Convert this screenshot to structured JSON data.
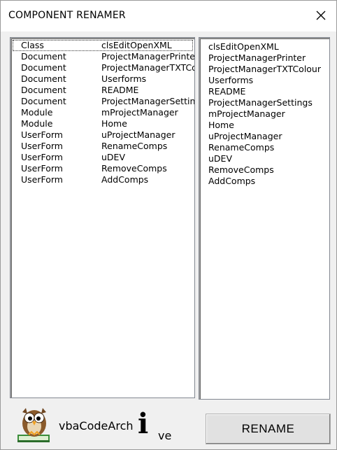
{
  "window": {
    "title": "COMPONENT RENAMER"
  },
  "left_list": {
    "rows": [
      {
        "type": "Class",
        "name": "clsEditOpenXML"
      },
      {
        "type": "Document",
        "name": "ProjectManagerPrinter"
      },
      {
        "type": "Document",
        "name": "ProjectManagerTXTColour"
      },
      {
        "type": "Document",
        "name": "Userforms"
      },
      {
        "type": "Document",
        "name": "README"
      },
      {
        "type": "Document",
        "name": "ProjectManagerSettings"
      },
      {
        "type": "Module",
        "name": "mProjectManager"
      },
      {
        "type": "Module",
        "name": "Home"
      },
      {
        "type": "UserForm",
        "name": "uProjectManager"
      },
      {
        "type": "UserForm",
        "name": "RenameComps"
      },
      {
        "type": "UserForm",
        "name": "uDEV"
      },
      {
        "type": "UserForm",
        "name": "RemoveComps"
      },
      {
        "type": "UserForm",
        "name": "AddComps"
      }
    ]
  },
  "right_list": {
    "items": [
      "clsEditOpenXML",
      "ProjectManagerPrinter",
      "ProjectManagerTXTColour",
      "Userforms",
      "README",
      "ProjectManagerSettings",
      "mProjectManager",
      "Home",
      "uProjectManager",
      "RenameComps",
      "uDEV",
      "RemoveComps",
      "AddComps"
    ]
  },
  "rename_button": {
    "label": "RENAME"
  },
  "branding": {
    "text_start": "vbaCodeArch",
    "text_i": "i",
    "text_end": "ve"
  }
}
